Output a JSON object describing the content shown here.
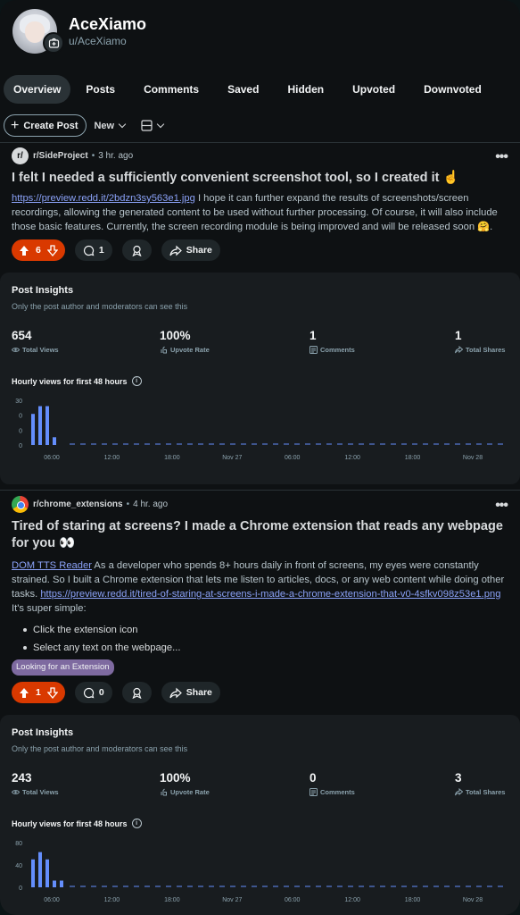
{
  "profile": {
    "display_name": "AceXiamo",
    "username": "u/AceXiamo"
  },
  "tabs": [
    {
      "label": "Overview",
      "active": true
    },
    {
      "label": "Posts"
    },
    {
      "label": "Comments"
    },
    {
      "label": "Saved"
    },
    {
      "label": "Hidden"
    },
    {
      "label": "Upvoted"
    },
    {
      "label": "Downvoted"
    }
  ],
  "toolbar": {
    "create_post": "Create Post",
    "sort": "New"
  },
  "posts": [
    {
      "subreddit": "r/SideProject",
      "sub_icon_text": "r/",
      "age": "3 hr. ago",
      "title": "I felt I needed a sufficiently convenient screenshot tool, so I created it ☝️",
      "link": "https://preview.redd.it/2bdzn3sy563e1.jpg",
      "body": " I hope it can further expand the results of screenshots/screen recordings, allowing the generated content to be used without further processing. Of course, it will also include those basic features. Currently, the screen recording module is being improved and will be released soon 🤗.",
      "votes": "6",
      "comments": "1",
      "share_label": "Share",
      "insights": {
        "title": "Post Insights",
        "subtitle": "Only the post author and moderators can see this",
        "stats": [
          {
            "value": "654",
            "label": "Total Views",
            "icon": "eye-icon"
          },
          {
            "value": "100%",
            "label": "Upvote Rate",
            "icon": "upvote-rate-icon"
          },
          {
            "value": "1",
            "label": "Comments",
            "icon": "comments-icon"
          },
          {
            "value": "1",
            "label": "Total Shares",
            "icon": "share-icon"
          }
        ],
        "hourly_label": "Hourly views for first 48 hours"
      }
    },
    {
      "subreddit": "r/chrome_extensions",
      "age": "4 hr. ago",
      "title": "Tired of staring at screens? I made a Chrome extension that reads any webpage for you 👀",
      "link1": "DOM TTS Reader",
      "body1": " As a developer who spends 8+ hours daily in front of screens, my eyes were constantly strained. So I built a Chrome extension that lets me listen to articles, docs, or any web content while doing other tasks. ",
      "link2": "https://preview.redd.it/tired-of-staring-at-screens-i-made-a-chrome-extension-that-v0-4sfkv098z53e1.png",
      "body2": " It's super simple:",
      "bullets": [
        "Click the extension icon",
        "Select any text on the webpage..."
      ],
      "flair": "Looking for an Extension",
      "votes": "1",
      "comments": "0",
      "share_label": "Share",
      "insights": {
        "title": "Post Insights",
        "subtitle": "Only the post author and moderators can see this",
        "stats": [
          {
            "value": "243",
            "label": "Total Views",
            "icon": "eye-icon"
          },
          {
            "value": "100%",
            "label": "Upvote Rate",
            "icon": "upvote-rate-icon"
          },
          {
            "value": "0",
            "label": "Comments",
            "icon": "comments-icon"
          },
          {
            "value": "3",
            "label": "Total Shares",
            "icon": "share-icon"
          }
        ],
        "hourly_label": "Hourly views for first 48 hours"
      }
    }
  ],
  "chart_data": [
    {
      "type": "bar",
      "title": "Hourly views for first 48 hours",
      "y_tick_labels": [
        "30",
        "0",
        "0",
        "0"
      ],
      "x_tick_labels": [
        "06:00",
        "12:00",
        "18:00",
        "Nov 27",
        "06:00",
        "12:00",
        "18:00",
        "Nov 28"
      ],
      "values": [
        28,
        35,
        35,
        7
      ],
      "bar_color": "#648efc"
    },
    {
      "type": "bar",
      "title": "Hourly views for first 48 hours",
      "y_tick_labels": [
        "80",
        "40",
        "0"
      ],
      "x_tick_labels": [
        "06:00",
        "12:00",
        "18:00",
        "Nov 27",
        "06:00",
        "12:00",
        "18:00",
        "Nov 28"
      ],
      "values": [
        50,
        63,
        50,
        12,
        12
      ],
      "ylim": [
        0,
        80
      ],
      "bar_color": "#648efc"
    }
  ],
  "colors": {
    "accent": "#648efc",
    "upvote": "#d93900",
    "flair": "#7e6aa0"
  }
}
